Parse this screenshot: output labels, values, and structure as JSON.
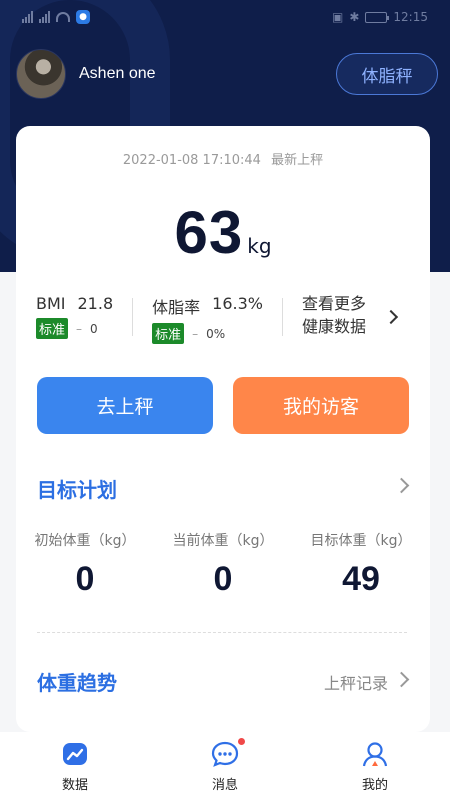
{
  "status_bar": {
    "time": "12:15"
  },
  "profile": {
    "name": "Ashen one"
  },
  "header": {
    "scale_button": "体脂秤"
  },
  "measurement": {
    "timestamp": "2022-01-08 17:10:44",
    "timestamp_note": "最新上秤",
    "weight": "63",
    "unit": "kg"
  },
  "metrics": {
    "bmi": {
      "label": "BMI",
      "value": "21.8",
      "tag": "标准",
      "dash": "–",
      "delta": "0"
    },
    "body_fat": {
      "label": "体脂率",
      "value": "16.3%",
      "tag": "标准",
      "dash": "–",
      "delta": "0%"
    },
    "more": {
      "line1": "查看更多",
      "line2": "健康数据"
    }
  },
  "actions": {
    "weigh": "去上秤",
    "visitors": "我的访客"
  },
  "goal_plan": {
    "title": "目标计划",
    "items": [
      {
        "label": "初始体重（kg）",
        "value": "0"
      },
      {
        "label": "当前体重（kg）",
        "value": "0"
      },
      {
        "label": "目标体重（kg）",
        "value": "49"
      }
    ]
  },
  "trend": {
    "title": "体重趋势",
    "records_link": "上秤记录"
  },
  "tabbar": {
    "items": [
      {
        "label": "数据",
        "icon": "chart-icon"
      },
      {
        "label": "消息",
        "icon": "message-icon"
      },
      {
        "label": "我的",
        "icon": "profile-icon"
      }
    ]
  },
  "colors": {
    "header_bg": "#0f1e4a",
    "accent_blue": "#2c6fe2",
    "button_blue": "#3a85ee",
    "button_orange": "#ff8649",
    "standard_green": "#1c8a2a"
  }
}
